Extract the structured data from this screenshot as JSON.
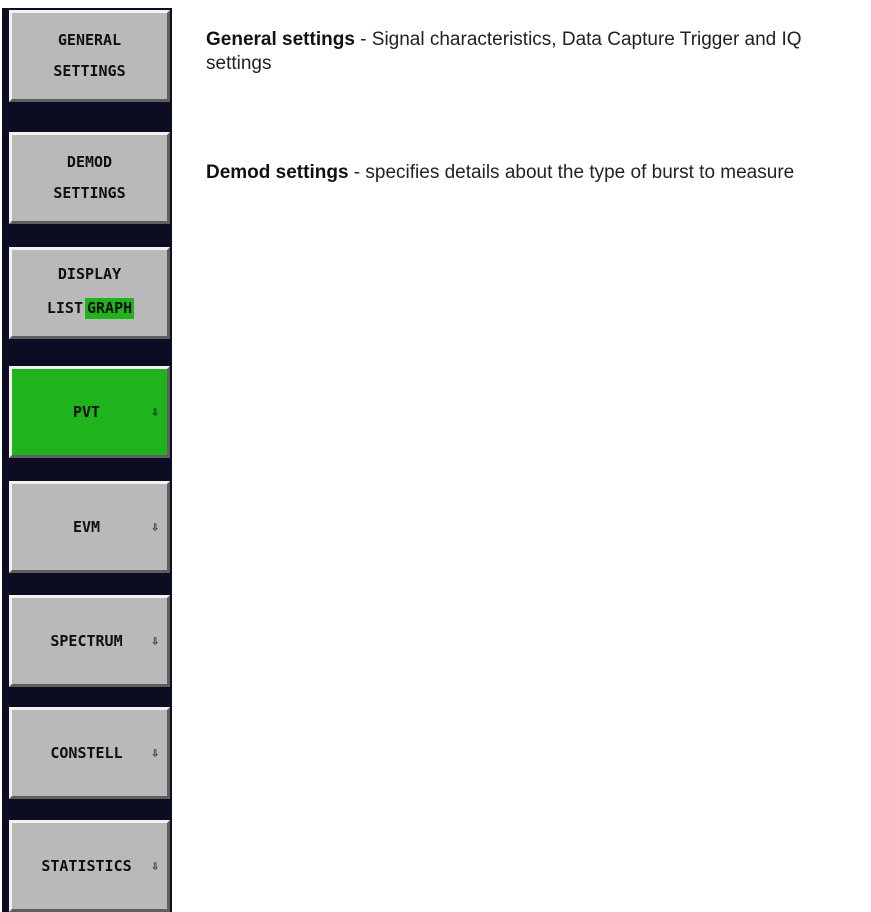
{
  "softkeys": [
    {
      "line1": "GENERAL",
      "line2": "SETTINGS"
    },
    {
      "line1": "DEMOD",
      "line2": "SETTINGS"
    },
    {
      "line1": "DISPLAY",
      "option_a": "LIST",
      "option_b": "GRAPH",
      "selected": "GRAPH"
    },
    {
      "label": "PVT",
      "arrow": "⇩",
      "active": true
    },
    {
      "label": "EVM",
      "arrow": "⇩"
    },
    {
      "label": "SPECTRUM",
      "arrow": "⇩"
    },
    {
      "label": "CONSTELL",
      "arrow": "⇩"
    },
    {
      "label": "STATISTICS",
      "arrow": "⇩"
    }
  ],
  "descriptions": {
    "general": {
      "title": "General settings",
      "text": " - Signal characteristics, Data Capture Trigger and IQ settings"
    },
    "demod": {
      "title": "Demod settings",
      "text": " - specifies details about the type of burst to measure"
    }
  },
  "colors": {
    "panel": "#0c0c22",
    "button": "#b9b9b9",
    "active": "#1fb41c"
  }
}
